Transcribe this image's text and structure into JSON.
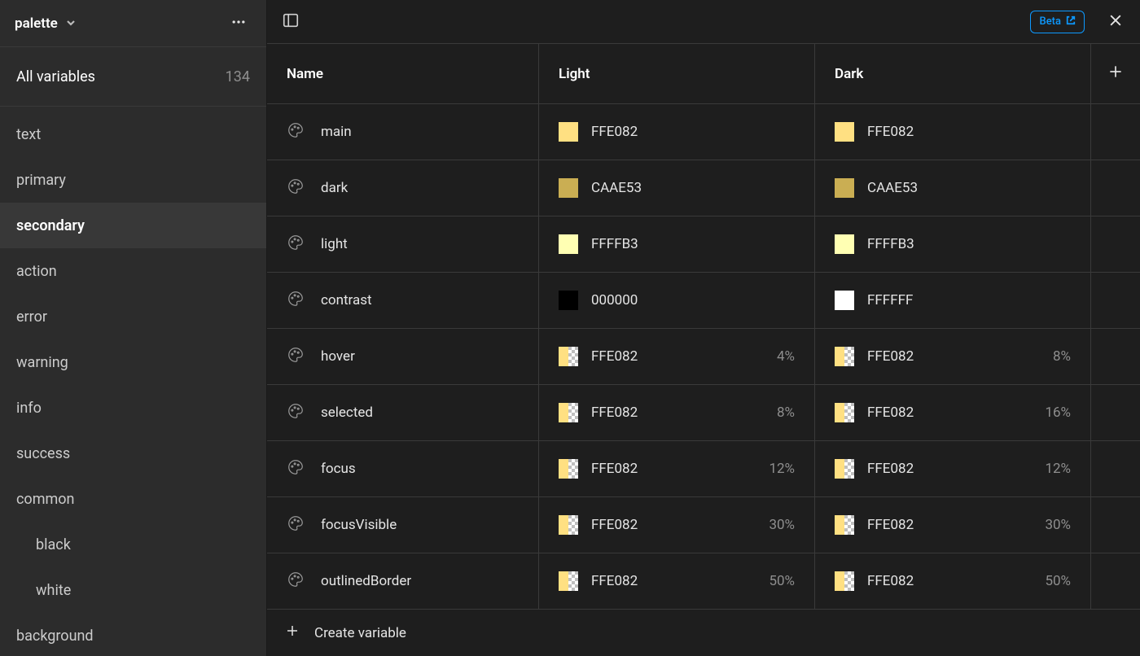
{
  "sidebar": {
    "collection_name": "palette",
    "all_variables_label": "All variables",
    "all_variables_count": "134",
    "groups": [
      {
        "label": "text",
        "active": false,
        "indent": 0
      },
      {
        "label": "primary",
        "active": false,
        "indent": 0
      },
      {
        "label": "secondary",
        "active": true,
        "indent": 0
      },
      {
        "label": "action",
        "active": false,
        "indent": 0
      },
      {
        "label": "error",
        "active": false,
        "indent": 0
      },
      {
        "label": "warning",
        "active": false,
        "indent": 0
      },
      {
        "label": "info",
        "active": false,
        "indent": 0
      },
      {
        "label": "success",
        "active": false,
        "indent": 0
      },
      {
        "label": "common",
        "active": false,
        "indent": 0
      },
      {
        "label": "black",
        "active": false,
        "indent": 1
      },
      {
        "label": "white",
        "active": false,
        "indent": 1
      },
      {
        "label": "background",
        "active": false,
        "indent": 0
      }
    ]
  },
  "topbar": {
    "beta_label": "Beta"
  },
  "table": {
    "headers": {
      "name": "Name",
      "mode1": "Light",
      "mode2": "Dark"
    },
    "rows": [
      {
        "name": "main",
        "light": {
          "hex": "FFE082",
          "color": "#FFE082",
          "alpha": false,
          "pct": null
        },
        "dark": {
          "hex": "FFE082",
          "color": "#FFE082",
          "alpha": false,
          "pct": null
        }
      },
      {
        "name": "dark",
        "light": {
          "hex": "CAAE53",
          "color": "#CAAE53",
          "alpha": false,
          "pct": null
        },
        "dark": {
          "hex": "CAAE53",
          "color": "#CAAE53",
          "alpha": false,
          "pct": null
        }
      },
      {
        "name": "light",
        "light": {
          "hex": "FFFFB3",
          "color": "#FFFFB3",
          "alpha": false,
          "pct": null
        },
        "dark": {
          "hex": "FFFFB3",
          "color": "#FFFFB3",
          "alpha": false,
          "pct": null
        }
      },
      {
        "name": "contrast",
        "light": {
          "hex": "000000",
          "color": "#000000",
          "alpha": false,
          "pct": null
        },
        "dark": {
          "hex": "FFFFFF",
          "color": "#FFFFFF",
          "alpha": false,
          "pct": null
        }
      },
      {
        "name": "hover",
        "light": {
          "hex": "FFE082",
          "color": "#FFE082",
          "alpha": true,
          "pct": "4%"
        },
        "dark": {
          "hex": "FFE082",
          "color": "#FFE082",
          "alpha": true,
          "pct": "8%"
        }
      },
      {
        "name": "selected",
        "light": {
          "hex": "FFE082",
          "color": "#FFE082",
          "alpha": true,
          "pct": "8%"
        },
        "dark": {
          "hex": "FFE082",
          "color": "#FFE082",
          "alpha": true,
          "pct": "16%"
        }
      },
      {
        "name": "focus",
        "light": {
          "hex": "FFE082",
          "color": "#FFE082",
          "alpha": true,
          "pct": "12%"
        },
        "dark": {
          "hex": "FFE082",
          "color": "#FFE082",
          "alpha": true,
          "pct": "12%"
        }
      },
      {
        "name": "focusVisible",
        "light": {
          "hex": "FFE082",
          "color": "#FFE082",
          "alpha": true,
          "pct": "30%"
        },
        "dark": {
          "hex": "FFE082",
          "color": "#FFE082",
          "alpha": true,
          "pct": "30%"
        }
      },
      {
        "name": "outlinedBorder",
        "light": {
          "hex": "FFE082",
          "color": "#FFE082",
          "alpha": true,
          "pct": "50%"
        },
        "dark": {
          "hex": "FFE082",
          "color": "#FFE082",
          "alpha": true,
          "pct": "50%"
        }
      }
    ],
    "create_label": "Create variable"
  }
}
